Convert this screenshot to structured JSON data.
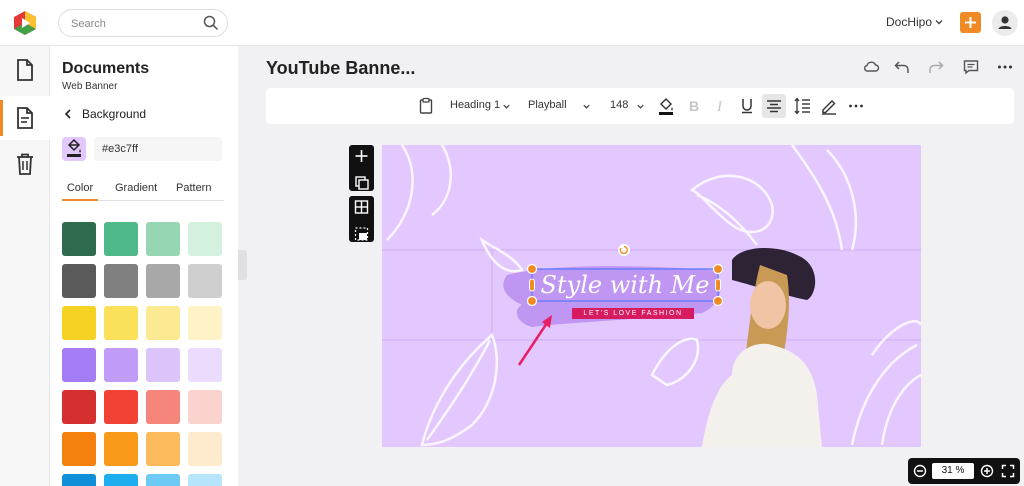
{
  "search": {
    "placeholder": "Search"
  },
  "header": {
    "brand": "DocHipo"
  },
  "panel": {
    "title": "Documents",
    "subtitle": "Web Banner",
    "back_label": "Background",
    "color_value": "#e3c7ff",
    "tabs": [
      "Color",
      "Gradient",
      "Pattern"
    ],
    "active_tab": "Color",
    "swatch_rows": [
      [
        "#2e6b4f",
        "#4fb98a",
        "#97d6b3",
        "#d4f0de"
      ],
      [
        "#5a5a5a",
        "#808080",
        "#a8a8a8",
        "#cfcfcf"
      ],
      [
        "#f6d322",
        "#fbe05a",
        "#fcea93",
        "#fdf3c6"
      ],
      [
        "#a47cf4",
        "#c09bf7",
        "#dcc3fa",
        "#ebdbfc"
      ],
      [
        "#d62f2f",
        "#f24236",
        "#f5857a",
        "#fbd3ce"
      ],
      [
        "#f5800d",
        "#fa9a1a",
        "#fdba5c",
        "#feebcd"
      ],
      [
        "#0f8fd8",
        "#1eaef0",
        "#6ccaf5",
        "#b6e4fa"
      ]
    ]
  },
  "document": {
    "title": "YouTube Banne..."
  },
  "toolbar": {
    "heading": "Heading 1",
    "font": "Playball",
    "size": "148"
  },
  "canvas": {
    "background": "#e3c7ff",
    "headline": "Style with Me",
    "tagline": "LET'S LOVE FASHION"
  },
  "zoom": {
    "value": "31 %"
  },
  "colors": {
    "accent": "#f08a24",
    "ribbon": "#d81b60"
  },
  "icons": [
    "search-icon",
    "chevron-down-icon",
    "plus-icon",
    "user-icon",
    "document-icon",
    "page-icon",
    "trash-icon",
    "paint-bucket-icon",
    "cloud-icon",
    "undo-icon",
    "redo-icon",
    "comment-icon",
    "more-icon",
    "clipboard-icon",
    "bold-icon",
    "italic-icon",
    "underline-icon",
    "align-center-icon",
    "line-height-icon",
    "pen-icon",
    "rotate-icon",
    "zoom-out-icon",
    "zoom-in-icon",
    "fullscreen-icon"
  ]
}
